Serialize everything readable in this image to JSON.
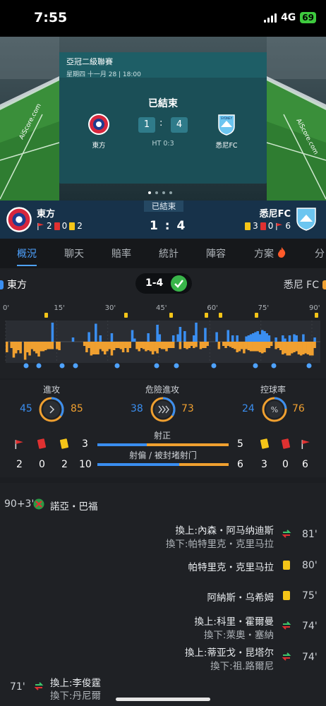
{
  "status_bar": {
    "time": "7:55",
    "network": "4G",
    "battery": "69"
  },
  "match_card": {
    "league": "亞冠二級聯賽",
    "date": "星期四 十一月 28 | 18:00",
    "status": "已結束",
    "home_name": "東方",
    "away_name": "悉尼FC",
    "home_score": "1",
    "away_score": "4",
    "colon": ":",
    "halftime": "HT 0:3",
    "watermark": "AiScore.com",
    "away_badge_text": "SYDNEY"
  },
  "score_bar": {
    "status": "已結束",
    "home_name": "東方",
    "away_name": "悉尼FC",
    "score": "1 : 4",
    "home_corners": "2",
    "home_red": "0",
    "home_yellow": "2",
    "away_yellow": "3",
    "away_red": "0",
    "away_corners": "6"
  },
  "tabs": [
    {
      "label": "概況",
      "active": true
    },
    {
      "label": "聊天"
    },
    {
      "label": "賠率"
    },
    {
      "label": "統計"
    },
    {
      "label": "陣容"
    },
    {
      "label": "方案"
    },
    {
      "label": "分"
    }
  ],
  "summary": {
    "home": "東方",
    "away": "悉尼 FC",
    "score": "1-4"
  },
  "momentum": {
    "ticks": [
      "0'",
      "15'",
      "30'",
      "45'",
      "60'",
      "75'",
      "90'"
    ],
    "home": [
      0,
      0,
      0,
      0,
      0,
      0,
      0,
      0,
      0,
      0,
      0,
      0,
      0,
      0,
      0,
      0,
      0,
      0,
      0,
      0,
      0.9,
      0,
      0,
      0,
      0,
      0,
      0,
      0,
      0,
      0.2,
      0,
      0,
      0,
      0,
      0,
      0,
      0.45,
      0,
      0,
      0.85,
      0,
      0.3,
      0,
      0,
      0,
      0,
      0.4,
      0,
      0,
      0,
      0,
      0,
      0,
      0,
      0,
      0.55,
      0.15,
      0,
      0,
      0,
      0,
      0,
      0.4,
      0,
      0,
      0,
      0.8,
      0.35,
      0,
      0,
      0,
      0,
      0,
      0.3,
      0,
      0.35,
      0.7,
      0,
      0.5,
      0,
      0,
      0,
      0.3,
      0.9,
      0,
      0,
      0,
      0.65,
      0,
      0,
      0,
      0,
      0.45,
      0,
      0,
      0,
      0,
      0.55,
      0,
      0.3,
      0,
      0.3,
      0,
      0,
      0,
      0.25,
      0.3,
      0.35,
      0.4,
      0.45,
      0.5,
      0.35,
      0.55,
      0.5,
      0.4,
      0.3,
      0,
      0,
      0.2,
      0,
      0,
      0.3,
      0.15,
      0,
      0.3,
      0,
      0.35,
      0.3,
      0,
      0,
      0.35,
      0,
      0,
      0,
      0,
      0.2,
      0,
      0
    ],
    "away": [
      0.5,
      0,
      0.3,
      0.75,
      0.55,
      0.4,
      0.55,
      0,
      0.85,
      0.5,
      0.65,
      0.35,
      0.45,
      0.55,
      0.7,
      0.45,
      0.45,
      0.4,
      0.35,
      0.35,
      0.35,
      0,
      0.35,
      0.4,
      0,
      0,
      0,
      0,
      0,
      0,
      0,
      0,
      0,
      0,
      0.2,
      0.5,
      0.3,
      0.65,
      0.6,
      0.6,
      0.6,
      0.35,
      0.45,
      0.6,
      0.45,
      0.35,
      0.65,
      0.4,
      0.3,
      0.3,
      0.35,
      0.5,
      0.3,
      0.5,
      0.3,
      0,
      0,
      0.35,
      0.45,
      0.3,
      0.35,
      0.45,
      0.4,
      0.45,
      0.6,
      0.45,
      0.55,
      0.3,
      0.35,
      0.35,
      0.45,
      0.3,
      0.3,
      0.3,
      0,
      0,
      0.35,
      0,
      0.3,
      0.35,
      0.3,
      0.2,
      0.3,
      0.25,
      0,
      0.35,
      0.3,
      0.3,
      0.2,
      0,
      0,
      0,
      0,
      0.35,
      0,
      0.2,
      0.3,
      0.2,
      0.25,
      0.3,
      0.35,
      0.5,
      0.45,
      0.35,
      0.55,
      0.35,
      0.4,
      0.45,
      0.45,
      0.45,
      0.45,
      0.5,
      0.55,
      0.5,
      0.3,
      0.3,
      0.2,
      0,
      0.35,
      0.3,
      0.4,
      0.6,
      0.55,
      0.65,
      0.65,
      0.55,
      0.5,
      0.45,
      0.6,
      0.65,
      0.6,
      0.55,
      0.6,
      0.65,
      0.65,
      0.3,
      0
    ]
  },
  "stats": {
    "attack": {
      "label": "進攻",
      "home": "45",
      "away": "85",
      "home_val": 45,
      "away_val": 85
    },
    "dangerous": {
      "label": "危險進攻",
      "home": "38",
      "away": "73",
      "home_val": 38,
      "away_val": 73
    },
    "possession": {
      "label": "控球率",
      "home": "24",
      "away": "76",
      "home_val": 24,
      "away_val": 76
    },
    "on_target": {
      "label": "射正",
      "home": "3",
      "away": "5",
      "home_val": 3,
      "away_val": 5
    },
    "off_target": {
      "label": "射偏 / 被封堵射门",
      "home": "10",
      "away": "6",
      "home_val": 10,
      "away_val": 6
    },
    "home_corners": "2",
    "home_red": "0",
    "home_yellow": "2",
    "away_yellow": "3",
    "away_red": "0",
    "away_corners": "6"
  },
  "events": [
    {
      "minute": "90+3'",
      "text": "諾亞・巴福"
    },
    {
      "minute": "81'",
      "in": "換上:內森・阿马纳迪斯",
      "out": "換下:帕特里克・克里马拉"
    },
    {
      "minute": "80'",
      "text": "帕特里克・克里马拉"
    },
    {
      "minute": "75'",
      "text": "阿納斯・乌希姆"
    },
    {
      "minute": "74'",
      "in": "換上:科里・霍爾曼",
      "out": "換下:萊奧・塞納"
    },
    {
      "minute": "74'",
      "in": "換上:蒂亚戈・昆塔尔",
      "out": "換下:祖.路爾尼"
    },
    {
      "minute": "71'",
      "in": "換上:李俊霆",
      "out": "換下:丹尼爾"
    }
  ],
  "colors": {
    "home": "#3a8ef0",
    "away": "#f0a030",
    "accent": "#4ea2ff"
  }
}
